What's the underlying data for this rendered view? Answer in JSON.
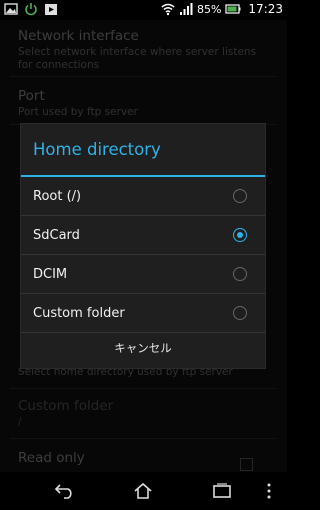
{
  "statusbar": {
    "battery_text": "85%",
    "time": "17:23",
    "left_icons": [
      "gallery-icon",
      "power-icon",
      "play-store-icon"
    ],
    "right_icons": [
      "wifi-icon",
      "signal-icon",
      "battery-icon"
    ]
  },
  "settings": {
    "items": [
      {
        "title": "Network interface",
        "summary": "Select network interface where server listens for connections"
      },
      {
        "title": "Port",
        "summary": "Port used by ftp server"
      },
      {
        "title": "",
        "summary": "Select home directory used by ftp server"
      },
      {
        "title": "Custom folder",
        "summary": "/"
      },
      {
        "title": "Read only",
        "summary": ""
      }
    ]
  },
  "dialog": {
    "title": "Home directory",
    "options": [
      {
        "label": "Root (/)",
        "selected": false
      },
      {
        "label": "SdCard",
        "selected": true
      },
      {
        "label": "DCIM",
        "selected": false
      },
      {
        "label": "Custom folder",
        "selected": false
      }
    ],
    "cancel_label": "キャンセル"
  },
  "colors": {
    "accent": "#2fb2e6",
    "dialog_bg": "#1f1f1f",
    "background": "#0c0c0c"
  },
  "navbar": {
    "icons": [
      "back-icon",
      "home-icon",
      "recent-apps-icon",
      "menu-icon"
    ]
  }
}
